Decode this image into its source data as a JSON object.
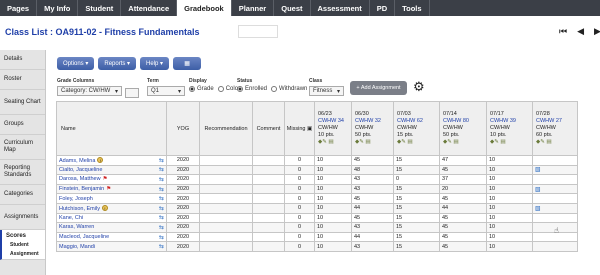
{
  "topnav": {
    "tabs": [
      {
        "label": "Pages",
        "active": false
      },
      {
        "label": "My Info",
        "active": false
      },
      {
        "label": "Student",
        "active": false
      },
      {
        "label": "Attendance",
        "active": false
      },
      {
        "label": "Gradebook",
        "active": true
      },
      {
        "label": "Planner",
        "active": false
      },
      {
        "label": "Quest",
        "active": false
      },
      {
        "label": "Assessment",
        "active": false
      },
      {
        "label": "PD",
        "active": false
      },
      {
        "label": "Tools",
        "active": false
      }
    ]
  },
  "header": {
    "title": "Class List : OA911-02 - Fitness Fundamentals",
    "nav_icons": [
      "first-page-icon",
      "previous-page-icon",
      "next-page-icon"
    ]
  },
  "sidebar": {
    "items": [
      {
        "label": "Details"
      },
      {
        "label": "Roster"
      },
      {
        "label": "Seating Chart"
      },
      {
        "label": "Groups"
      },
      {
        "label": "Curriculum Map"
      },
      {
        "label": "Reporting Standards"
      },
      {
        "label": "Categories"
      },
      {
        "label": "Assignments"
      }
    ],
    "active": {
      "label": "Scores",
      "sub1": "Student",
      "sub2": "Assignment"
    }
  },
  "toolbar": {
    "options_label": "Options ▾",
    "reports_label": "Reports ▾",
    "help_label": "Help ▾",
    "grid_icon": "grid-view-icon"
  },
  "filters": {
    "grade_columns_label": "Grade Columns",
    "grade_columns_value": "Category: CW/HW",
    "term_label": "Term",
    "term_value": "Q1",
    "display_label": "Display",
    "display_grade": "Grade",
    "display_color": "Color",
    "status_label": "Status",
    "status_enrolled": "Enrolled",
    "status_withdrawn": "Withdrawn",
    "class_label": "Class",
    "class_value": "Fitness",
    "add_assignment_label": "+ Add Assignment"
  },
  "table": {
    "headers": {
      "name": "Name",
      "yog": "YOG",
      "recommendation": "Recommendation",
      "comment": "Comment",
      "missing": "Missing"
    },
    "assignments": [
      {
        "date": "06/23",
        "name": "CWHW 34",
        "type": "CW/HW",
        "points": "10 pts."
      },
      {
        "date": "06/30",
        "name": "CWHW 32",
        "type": "CWHW",
        "points": "50 pts."
      },
      {
        "date": "07/03",
        "name": "CWHW 62",
        "type": "CW/HW",
        "points": "15 pts."
      },
      {
        "date": "07/14",
        "name": "CWHW 80",
        "type": "CW/HW",
        "points": "50 pts."
      },
      {
        "date": "07/17",
        "name": "CWHW 39",
        "type": "CW/HW",
        "points": "10 pts."
      },
      {
        "date": "07/28",
        "name": "CWHW 27",
        "type": "CW/HW",
        "points": "60 pts."
      }
    ],
    "rows": [
      {
        "name": "Adams, Melina",
        "mark": "alert",
        "yog": "2020",
        "missing": "0",
        "scores": [
          "10",
          "45",
          "15",
          "47",
          "10",
          ""
        ]
      },
      {
        "name": "Cialto, Jacqueline",
        "mark": "",
        "yog": "2020",
        "missing": "0",
        "scores": [
          "10",
          "48",
          "15",
          "45",
          "10",
          "icon"
        ]
      },
      {
        "name": "Darosa, Matthew",
        "mark": "flag",
        "yog": "2020",
        "missing": "0",
        "scores": [
          "10",
          "43",
          "0",
          "37",
          "10",
          ""
        ]
      },
      {
        "name": "Finstein, Benjamin",
        "mark": "flag",
        "yog": "2020",
        "missing": "0",
        "scores": [
          "10",
          "43",
          "15",
          "20",
          "10",
          "icon"
        ]
      },
      {
        "name": "Foley, Joseph",
        "mark": "",
        "yog": "2020",
        "missing": "0",
        "scores": [
          "10",
          "45",
          "15",
          "45",
          "10",
          ""
        ]
      },
      {
        "name": "Hutchison, Emily",
        "mark": "alert",
        "yog": "2020",
        "missing": "0",
        "scores": [
          "10",
          "44",
          "15",
          "44",
          "10",
          "icon"
        ]
      },
      {
        "name": "Kane, Chi",
        "mark": "",
        "yog": "2020",
        "missing": "0",
        "scores": [
          "10",
          "45",
          "15",
          "45",
          "10",
          ""
        ]
      },
      {
        "name": "Karas, Warren",
        "mark": "",
        "yog": "2020",
        "missing": "0",
        "scores": [
          "10",
          "43",
          "15",
          "45",
          "10",
          ""
        ]
      },
      {
        "name": "Macleod, Jacqueline",
        "mark": "",
        "yog": "2020",
        "missing": "0",
        "scores": [
          "10",
          "44",
          "15",
          "45",
          "10",
          ""
        ]
      },
      {
        "name": "Maggio, Mandi",
        "mark": "",
        "yog": "2020",
        "missing": "0",
        "scores": [
          "10",
          "43",
          "15",
          "45",
          "10",
          ""
        ]
      }
    ]
  }
}
